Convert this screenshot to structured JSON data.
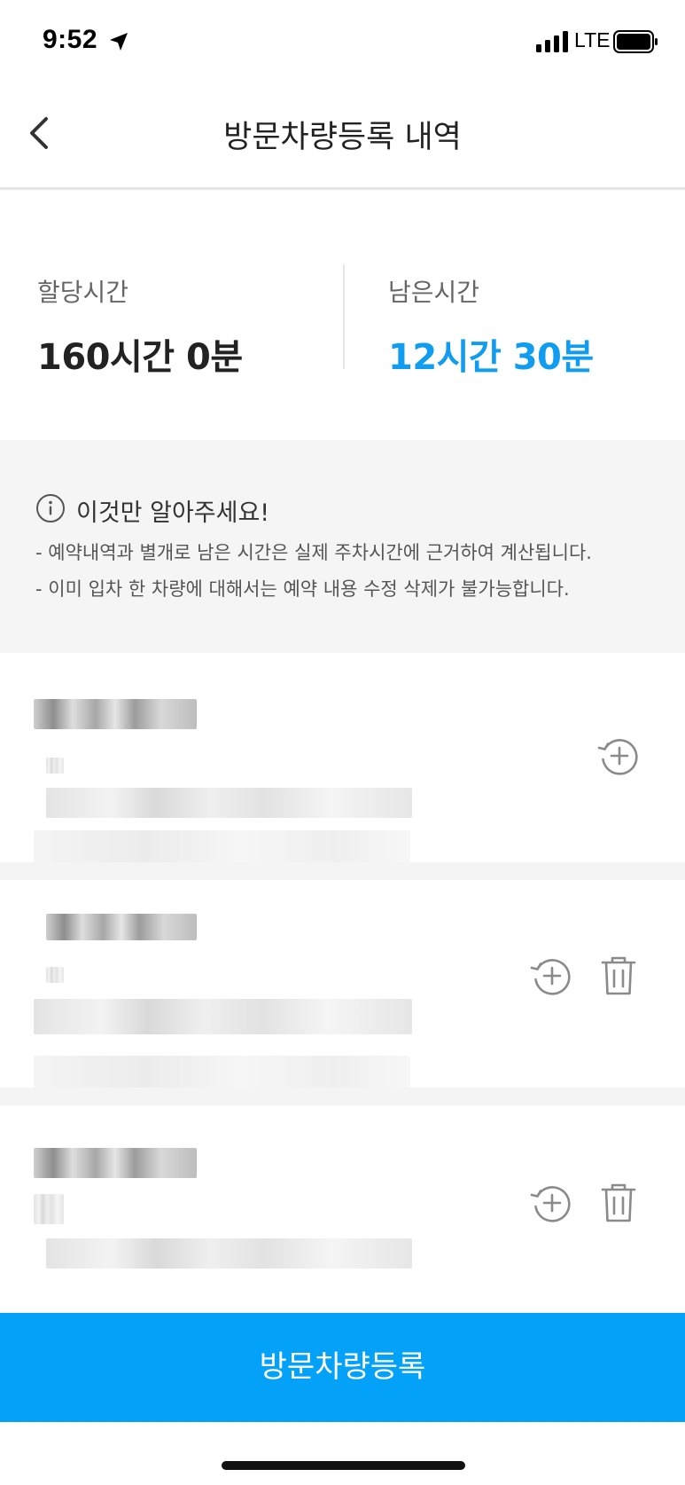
{
  "status_bar": {
    "time": "9:52",
    "network": "LTE"
  },
  "header": {
    "title": "방문차량등록 내역"
  },
  "time_summary": {
    "allocated": {
      "label": "할당시간",
      "value": "160시간 0분"
    },
    "remaining": {
      "label": "남은시간",
      "value": "12시간 30분",
      "color": "#109cf1"
    }
  },
  "notice": {
    "title": "이것만 알아주세요!",
    "lines": [
      "- 예약내역과 별개로 남은 시간은 실제 주차시간에 근거하여 계산됩니다.",
      "- 이미 입차 한 차량에 대해서는 예약 내용 수정 삭제가 불가능합니다."
    ]
  },
  "reservations": [
    {
      "actions": [
        "extend-icon"
      ]
    },
    {
      "actions": [
        "extend-icon",
        "delete-icon"
      ]
    },
    {
      "actions": [
        "extend-icon",
        "delete-icon"
      ]
    }
  ],
  "bottom_button": {
    "label": "방문차량등록",
    "color": "#04a1f8"
  }
}
